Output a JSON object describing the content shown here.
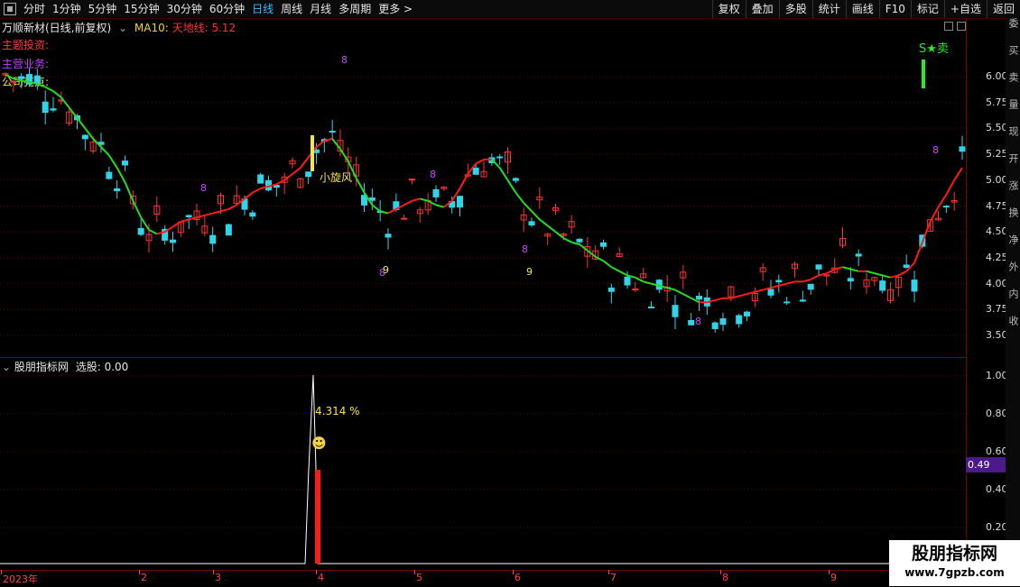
{
  "toolbar": {
    "intervals": [
      "分时",
      "1分钟",
      "5分钟",
      "15分钟",
      "30分钟",
      "60分钟",
      "日线",
      "周线",
      "月线",
      "多周期",
      "更多 >"
    ],
    "active_index": 6,
    "right_buttons": [
      "复权",
      "叠加",
      "多股",
      "统计",
      "画线",
      "F10",
      "标记",
      "+自选",
      "返回"
    ]
  },
  "chart_header": {
    "title": "万顺新材(日线,前复权)",
    "ma_label": "MA10:",
    "tdx_label": "天地线: 5.12"
  },
  "info_lines": {
    "theme": "主题投资:",
    "business": "主营业务:",
    "highlight": "公司亮点:"
  },
  "annotations": {
    "sell": "S★卖",
    "xiaoxuanfeng": "小旋风",
    "pct": "4.314 %",
    "smiley": "☻"
  },
  "price_axis": [
    "6.00",
    "5.75",
    "5.50",
    "5.25",
    "5.00",
    "4.75",
    "4.50",
    "4.25",
    "4.00",
    "3.75",
    "3.50"
  ],
  "indicator": {
    "title": "股朋指标网",
    "select_label": "选股: 0.00",
    "axis": [
      "1.00",
      "0.80",
      "0.60",
      "0.40",
      "0.20"
    ],
    "badge": "0.49"
  },
  "date_axis": [
    "2023年",
    "2",
    "3",
    "4",
    "5",
    "6",
    "7",
    "8",
    "9"
  ],
  "side_strip": [
    "委",
    "买",
    "卖",
    "量",
    "现",
    "开",
    "涨",
    "换",
    "净",
    "外",
    "内",
    "收"
  ],
  "watermark": {
    "title": "股朋指标网",
    "url": "www.7gpzb.com"
  },
  "colors": {
    "up": "#ff3333",
    "down": "#2fd4e8",
    "ma_green": "#22dd22",
    "ma_red": "#ff1a1a"
  },
  "chart_data": {
    "type": "candlestick",
    "price_range": [
      3.4,
      6.2
    ],
    "ma10_close_approx": [
      6.02,
      5.98,
      5.96,
      5.95,
      5.93,
      5.9,
      5.86,
      5.8,
      5.7,
      5.6,
      5.5,
      5.4,
      5.32,
      5.24,
      5.12,
      4.98,
      4.8,
      4.64,
      4.52,
      4.48,
      4.5,
      4.55,
      4.6,
      4.62,
      4.64,
      4.66,
      4.68,
      4.7,
      4.72,
      4.76,
      4.82,
      4.88,
      4.92,
      4.94,
      4.96,
      5.0,
      5.06,
      5.12,
      5.22,
      5.32,
      5.38,
      5.4,
      5.3,
      5.18,
      5.02,
      4.88,
      4.76,
      4.7,
      4.68,
      4.72,
      4.76,
      4.8,
      4.82,
      4.8,
      4.76,
      4.74,
      4.8,
      4.92,
      5.06,
      5.16,
      5.2,
      5.2,
      5.12,
      5.0,
      4.88,
      4.78,
      4.7,
      4.62,
      4.56,
      4.5,
      4.44,
      4.4,
      4.38,
      4.32,
      4.26,
      4.22,
      4.16,
      4.12,
      4.08,
      4.06,
      4.02,
      4.0,
      3.98,
      3.96,
      3.94,
      3.9,
      3.86,
      3.82,
      3.82,
      3.84,
      3.86,
      3.86,
      3.88,
      3.9,
      3.92,
      3.94,
      3.96,
      3.98,
      4.0,
      4.02,
      4.02,
      4.04,
      4.08,
      4.1,
      4.14,
      4.16,
      4.14,
      4.12,
      4.12,
      4.1,
      4.08,
      4.06,
      4.08,
      4.12,
      4.2,
      4.4,
      4.6,
      4.74,
      4.86,
      5.0,
      5.12
    ]
  }
}
